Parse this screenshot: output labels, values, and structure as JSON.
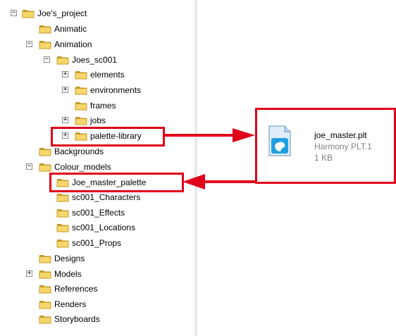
{
  "tree": [
    {
      "id": "joes-project",
      "label": "Joe's_project",
      "expander": "⊟"
    },
    {
      "id": "animatic",
      "label": "Animatic",
      "expander": null
    },
    {
      "id": "animation",
      "label": "Animation",
      "expander": "⊟"
    },
    {
      "id": "joes-sc001",
      "label": "Joes_sc001",
      "expander": "⊟"
    },
    {
      "id": "elements",
      "label": "elements",
      "expander": "⊞"
    },
    {
      "id": "environments",
      "label": "environments",
      "expander": "⊞"
    },
    {
      "id": "frames",
      "label": "frames",
      "expander": null
    },
    {
      "id": "jobs",
      "label": "jobs",
      "expander": "⊞"
    },
    {
      "id": "palette-library",
      "label": "palette-library",
      "expander": "⊞"
    },
    {
      "id": "backgrounds",
      "label": "Backgrounds",
      "expander": null
    },
    {
      "id": "colour-models",
      "label": "Colour_models",
      "expander": "⊟"
    },
    {
      "id": "joe-master-palette",
      "label": "Joe_master_palette",
      "expander": null
    },
    {
      "id": "sc001-characters",
      "label": "sc001_Characters",
      "expander": null
    },
    {
      "id": "sc001-effects",
      "label": "sc001_Effects",
      "expander": null
    },
    {
      "id": "sc001-locations",
      "label": "sc001_Locations",
      "expander": null
    },
    {
      "id": "sc001-props",
      "label": "sc001_Props",
      "expander": null
    },
    {
      "id": "designs",
      "label": "Designs",
      "expander": null
    },
    {
      "id": "models",
      "label": "Models",
      "expander": "⊞"
    },
    {
      "id": "references",
      "label": "References",
      "expander": null
    },
    {
      "id": "renders",
      "label": "Renders",
      "expander": null
    },
    {
      "id": "storyboards",
      "label": "Storyboards",
      "expander": null
    }
  ],
  "file": {
    "name": "joe_master.plt",
    "type": "Harmony PLT.1",
    "size": "1 KB",
    "icon": "palette-file-icon"
  },
  "colors": {
    "highlight": "#e0001b",
    "folder_fill": "#f7d66b",
    "folder_edge": "#c59b2a"
  }
}
